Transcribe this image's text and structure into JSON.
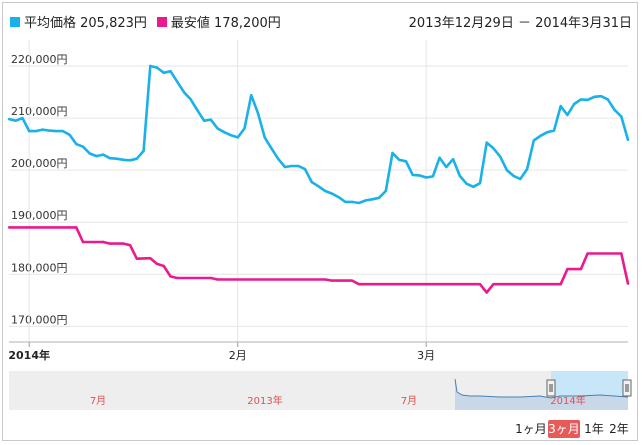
{
  "legend": {
    "avg_label": "平均価格 205,823円",
    "min_label": "最安値 178,200円"
  },
  "date_range": "2013年12月29日 － 2014年3月31日",
  "colors": {
    "avg": "#1ab1ea",
    "min": "#ea1a8e",
    "grid": "#e6e6e6",
    "navigator_fill": "#c7e6f7"
  },
  "range_buttons": [
    {
      "label": "1ヶ月",
      "active": false
    },
    {
      "label": "3ヶ月",
      "active": true
    },
    {
      "label": "1年",
      "active": false
    },
    {
      "label": "2年",
      "active": false
    }
  ],
  "navigator": {
    "labels": [
      "7月",
      "2013年",
      "7月",
      "2014年"
    ]
  },
  "chart_data": {
    "type": "line",
    "ylim": [
      167000,
      225000
    ],
    "y_ticks": [
      170000,
      180000,
      190000,
      200000,
      210000,
      220000
    ],
    "y_tick_labels": [
      "170,000円",
      "180,000円",
      "190,000円",
      "200,000円",
      "210,000円",
      "220,000円"
    ],
    "x_range": [
      "2013-12-29",
      "2014-03-31"
    ],
    "x_ticks": [
      {
        "date": "2014-01-01",
        "label": "2014年"
      },
      {
        "date": "2014-02-01",
        "label": "2月"
      },
      {
        "date": "2014-03-01",
        "label": "3月"
      }
    ],
    "series": [
      {
        "name": "平均価格",
        "points": [
          [
            "2013-12-29",
            209800
          ],
          [
            "2013-12-30",
            209500
          ],
          [
            "2013-12-31",
            210000
          ],
          [
            "2014-01-01",
            207500
          ],
          [
            "2014-01-02",
            207500
          ],
          [
            "2014-01-03",
            207800
          ],
          [
            "2014-01-04",
            207600
          ],
          [
            "2014-01-05",
            207500
          ],
          [
            "2014-01-06",
            207500
          ],
          [
            "2014-01-07",
            206800
          ],
          [
            "2014-01-08",
            205000
          ],
          [
            "2014-01-09",
            204500
          ],
          [
            "2014-01-10",
            203200
          ],
          [
            "2014-01-11",
            202700
          ],
          [
            "2014-01-12",
            203000
          ],
          [
            "2014-01-13",
            202300
          ],
          [
            "2014-01-14",
            202200
          ],
          [
            "2014-01-15",
            202000
          ],
          [
            "2014-01-16",
            201900
          ],
          [
            "2014-01-17",
            202200
          ],
          [
            "2014-01-18",
            203700
          ],
          [
            "2014-01-19",
            220000
          ],
          [
            "2014-01-20",
            219700
          ],
          [
            "2014-01-21",
            218700
          ],
          [
            "2014-01-22",
            219000
          ],
          [
            "2014-01-23",
            217000
          ],
          [
            "2014-01-24",
            215000
          ],
          [
            "2014-01-25",
            213600
          ],
          [
            "2014-01-26",
            211500
          ],
          [
            "2014-01-27",
            209500
          ],
          [
            "2014-01-28",
            209700
          ],
          [
            "2014-01-29",
            208000
          ],
          [
            "2014-01-30",
            207300
          ],
          [
            "2014-01-31",
            206700
          ],
          [
            "2014-02-01",
            206300
          ],
          [
            "2014-02-02",
            208000
          ],
          [
            "2014-02-03",
            214400
          ],
          [
            "2014-02-04",
            211000
          ],
          [
            "2014-02-05",
            206300
          ],
          [
            "2014-02-06",
            204200
          ],
          [
            "2014-02-07",
            202200
          ],
          [
            "2014-02-08",
            200600
          ],
          [
            "2014-02-09",
            200800
          ],
          [
            "2014-02-10",
            200800
          ],
          [
            "2014-02-11",
            200200
          ],
          [
            "2014-02-12",
            197700
          ],
          [
            "2014-02-13",
            196900
          ],
          [
            "2014-02-14",
            196000
          ],
          [
            "2014-02-15",
            195500
          ],
          [
            "2014-02-16",
            194800
          ],
          [
            "2014-02-17",
            193900
          ],
          [
            "2014-02-18",
            193900
          ],
          [
            "2014-02-19",
            193700
          ],
          [
            "2014-02-20",
            194200
          ],
          [
            "2014-02-21",
            194400
          ],
          [
            "2014-02-22",
            194700
          ],
          [
            "2014-02-23",
            196000
          ],
          [
            "2014-02-24",
            203300
          ],
          [
            "2014-02-25",
            202000
          ],
          [
            "2014-02-26",
            201700
          ],
          [
            "2014-02-27",
            199100
          ],
          [
            "2014-02-28",
            199000
          ],
          [
            "2014-03-01",
            198600
          ],
          [
            "2014-03-02",
            198800
          ],
          [
            "2014-03-03",
            202400
          ],
          [
            "2014-03-04",
            200600
          ],
          [
            "2014-03-05",
            202100
          ],
          [
            "2014-03-06",
            198900
          ],
          [
            "2014-03-07",
            197400
          ],
          [
            "2014-03-08",
            196800
          ],
          [
            "2014-03-09",
            197500
          ],
          [
            "2014-03-10",
            205300
          ],
          [
            "2014-03-11",
            204200
          ],
          [
            "2014-03-12",
            202600
          ],
          [
            "2014-03-13",
            200000
          ],
          [
            "2014-03-14",
            198900
          ],
          [
            "2014-03-15",
            198300
          ],
          [
            "2014-03-16",
            200200
          ],
          [
            "2014-03-17",
            205700
          ],
          [
            "2014-03-18",
            206600
          ],
          [
            "2014-03-19",
            207300
          ],
          [
            "2014-03-20",
            207600
          ],
          [
            "2014-03-21",
            212300
          ],
          [
            "2014-03-22",
            210600
          ],
          [
            "2014-03-23",
            212700
          ],
          [
            "2014-03-24",
            213600
          ],
          [
            "2014-03-25",
            213500
          ],
          [
            "2014-03-26",
            214100
          ],
          [
            "2014-03-27",
            214200
          ],
          [
            "2014-03-28",
            213600
          ],
          [
            "2014-03-29",
            211600
          ],
          [
            "2014-03-30",
            210300
          ],
          [
            "2014-03-31",
            205823
          ]
        ]
      },
      {
        "name": "最安値",
        "points": [
          [
            "2013-12-29",
            189000
          ],
          [
            "2014-01-08",
            189000
          ],
          [
            "2014-01-09",
            186200
          ],
          [
            "2014-01-12",
            186200
          ],
          [
            "2014-01-13",
            185900
          ],
          [
            "2014-01-15",
            185900
          ],
          [
            "2014-01-16",
            185600
          ],
          [
            "2014-01-17",
            183000
          ],
          [
            "2014-01-19",
            183100
          ],
          [
            "2014-01-20",
            182000
          ],
          [
            "2014-01-21",
            181600
          ],
          [
            "2014-01-22",
            179600
          ],
          [
            "2014-01-23",
            179300
          ],
          [
            "2014-01-28",
            179300
          ],
          [
            "2014-01-29",
            179000
          ],
          [
            "2014-02-14",
            179000
          ],
          [
            "2014-02-15",
            178800
          ],
          [
            "2014-02-18",
            178800
          ],
          [
            "2014-02-19",
            178100
          ],
          [
            "2014-03-09",
            178100
          ],
          [
            "2014-03-10",
            176500
          ],
          [
            "2014-03-11",
            178100
          ],
          [
            "2014-03-21",
            178100
          ],
          [
            "2014-03-22",
            181000
          ],
          [
            "2014-03-24",
            181000
          ],
          [
            "2014-03-25",
            184000
          ],
          [
            "2014-03-30",
            184000
          ],
          [
            "2014-03-31",
            178200
          ]
        ]
      }
    ]
  }
}
